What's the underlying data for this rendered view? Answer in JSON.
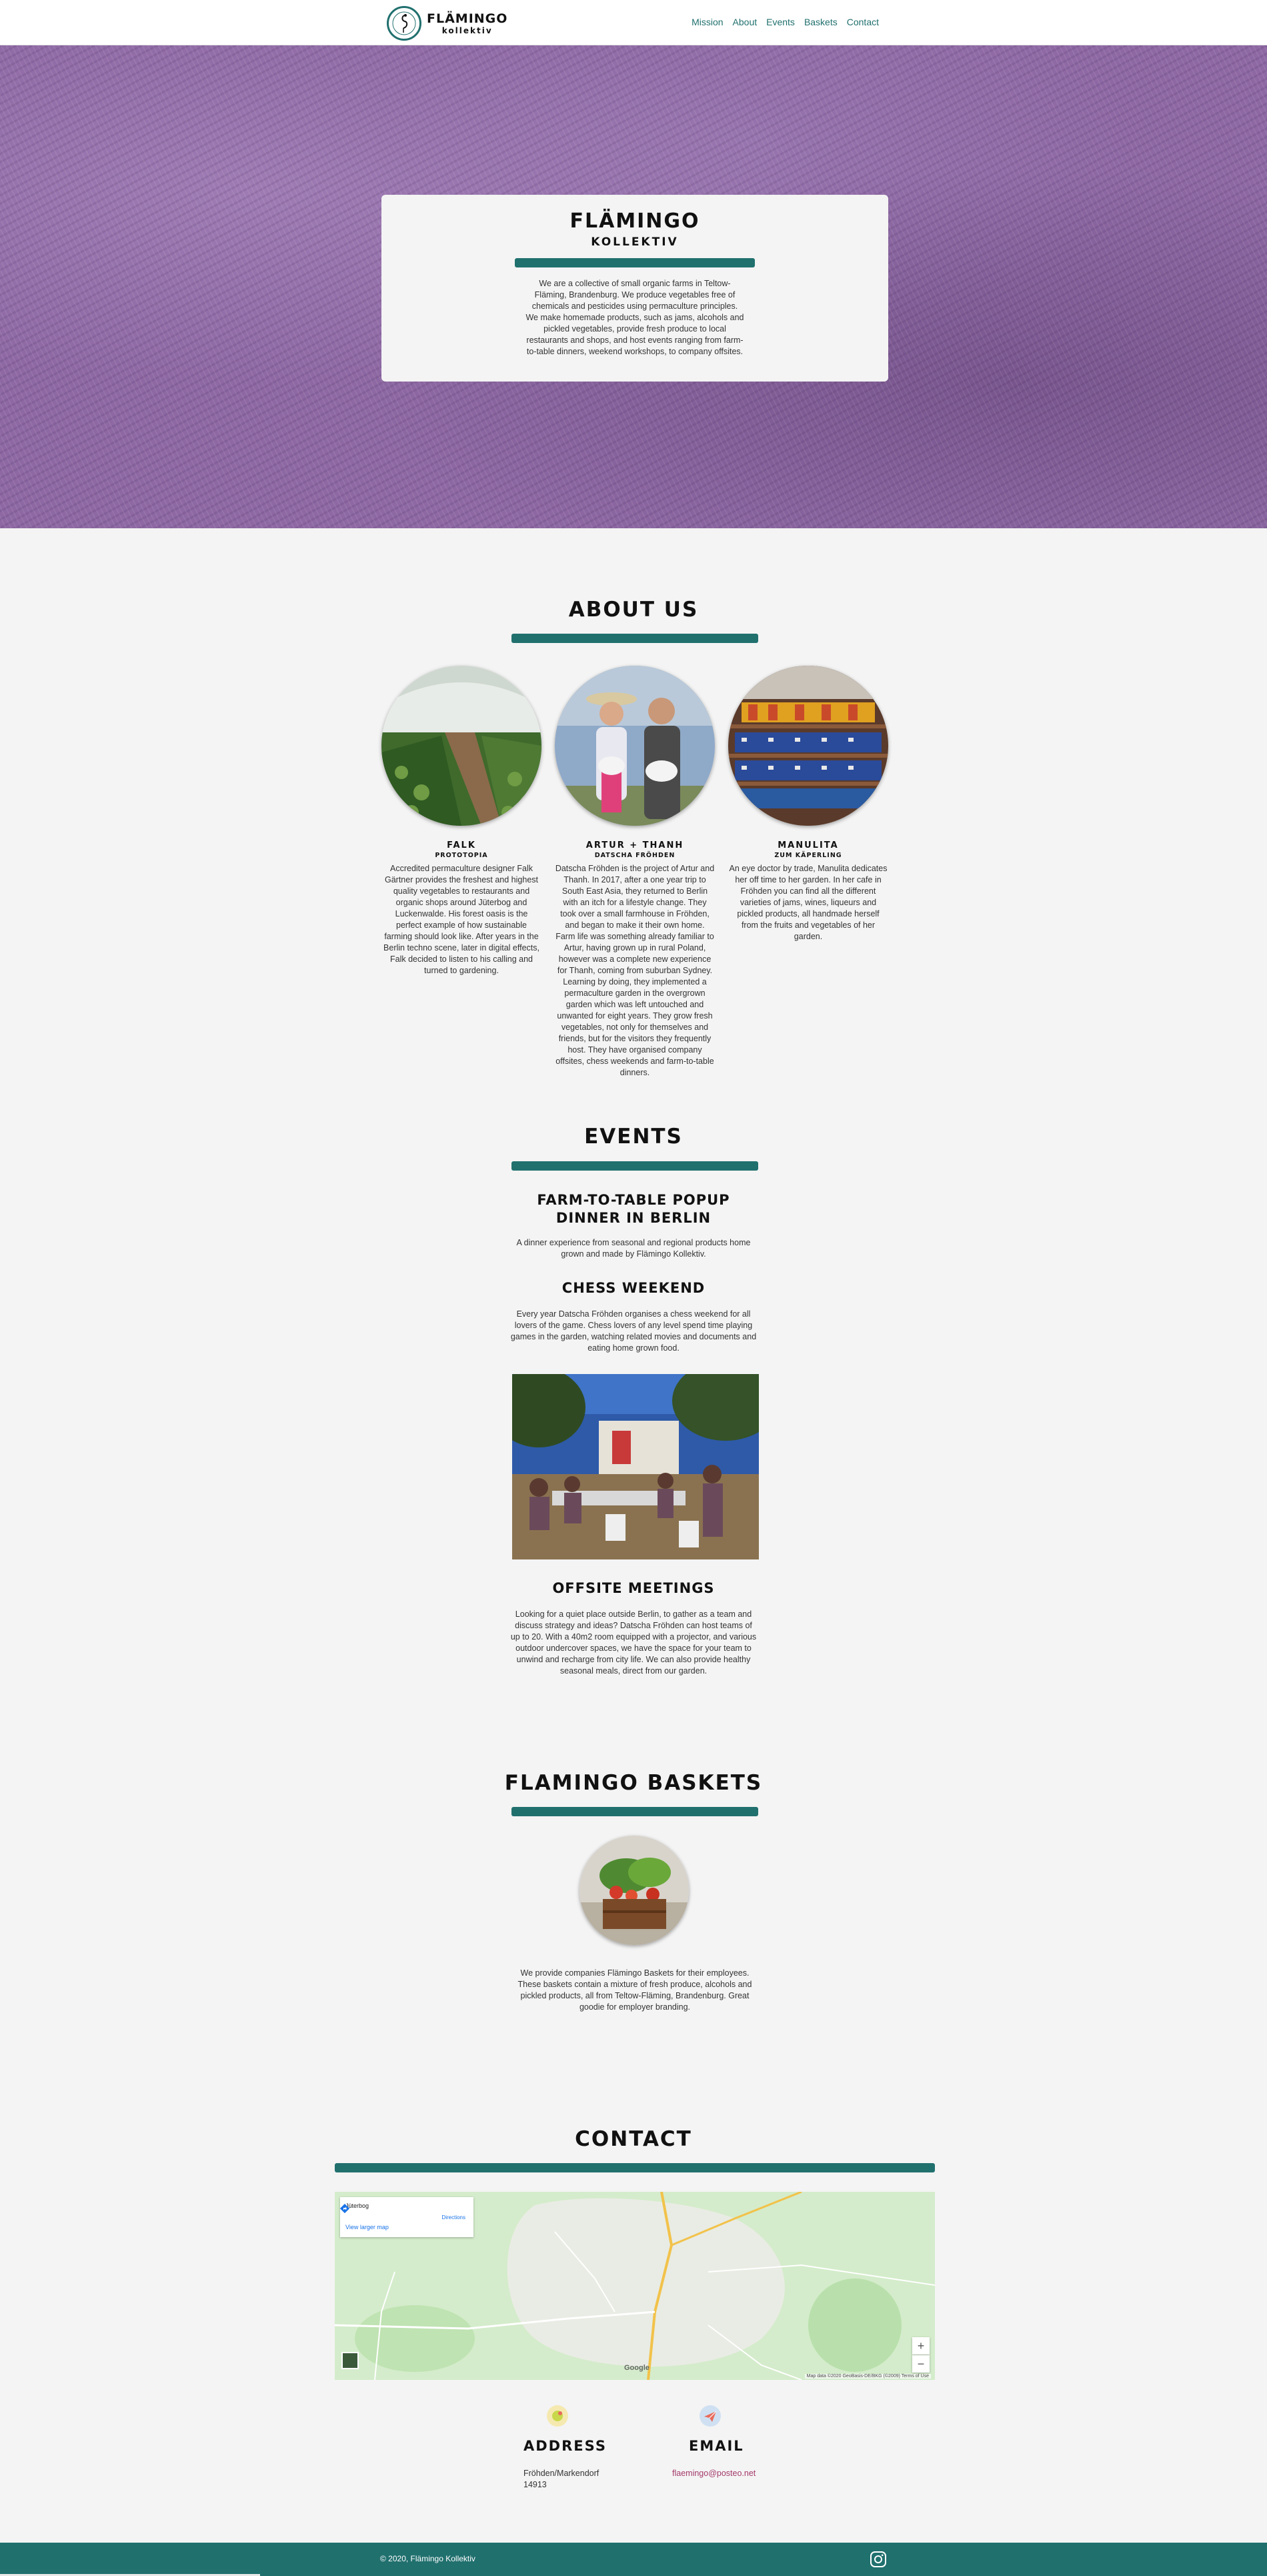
{
  "nav": {
    "logo_title": "FLÄMINGO",
    "logo_sub": "kollektiv",
    "links": [
      "Mission",
      "About",
      "Events",
      "Baskets",
      "Contact"
    ]
  },
  "hero": {
    "title": "FLÄMINGO",
    "subtitle": "KOLLEKTIV",
    "text": "We are a collective of small organic farms in Teltow-Fläming, Brandenburg. We produce vegetables free of chemicals and pesticides using permaculture principles. We make homemade products, such as jams, alcohols and pickled vegetables, provide fresh produce to local restaurants and shops, and host events ranging from farm-to-table dinners, weekend workshops, to company offsites."
  },
  "about": {
    "title": "ABOUT US",
    "people": [
      {
        "name": "FALK",
        "role": "PROTOTOPIA",
        "bio": "Accredited permaculture designer Falk Gärtner provides the freshest and highest quality vegetables to restaurants and organic shops around Jüterbog and Luckenwalde. His forest oasis is the perfect example of how sustainable farming should look like. After years in the Berlin techno scene, later in digital effects, Falk decided to listen to his calling and turned to gardening."
      },
      {
        "name": "ARTUR + THANH",
        "role": "DATSCHA FRÖHDEN",
        "bio": "Datscha Fröhden is the project of Artur and Thanh. In 2017, after a one year trip to South East Asia, they returned to Berlin with an itch for a lifestyle change. They took over a small farmhouse in Fröhden, and began to make it their own home. Farm life was something already familiar to Artur, having grown up in rural Poland, however was a complete new experience for Thanh, coming from suburban Sydney. Learning by doing, they implemented a permaculture garden in the overgrown garden which was left untouched and unwanted for eight years. They grow fresh vegetables, not only for themselves and friends, but for the visitors they frequently host. They have organised company offsites, chess weekends and farm-to-table dinners."
      },
      {
        "name": "MANULITA",
        "role": "ZUM KÄPERLING",
        "bio": "An eye doctor by trade, Manulita dedicates her off time to her garden. In her cafe in Fröhden you can find all the different varieties of jams, wines, liqueurs and pickled products, all handmade herself from the fruits and vegetables of her garden."
      }
    ]
  },
  "events": {
    "title": "EVENTS",
    "items": [
      {
        "title": "FARM-TO-TABLE POPUP DINNER IN BERLIN",
        "text": "A dinner experience from seasonal and regional products home grown and made by Flämingo Kollektiv."
      },
      {
        "title": "CHESS WEEKEND",
        "text": "Every year Datscha Fröhden organises a chess weekend for all lovers of the game. Chess lovers of any level spend time playing games in the garden, watching related movies and documents and eating home grown food."
      },
      {
        "title": "OFFSITE MEETINGS",
        "text": "Looking for a quiet place outside Berlin, to gather as a team and discuss strategy and ideas? Datscha Fröhden can host teams of up to 20. With a 40m2 room equipped with a projector, and various outdoor undercover spaces, we have the space for your team to unwind and recharge from city life. We can also provide healthy seasonal meals, direct from our garden."
      }
    ]
  },
  "baskets": {
    "title": "FLAMINGO BASKETS",
    "text": "We provide companies Flämingo Baskets for their employees. These baskets contain a mixture of fresh produce, alcohols and pickled products, all from Teltow-Fläming, Brandenburg. Great goodie for employer branding."
  },
  "contact": {
    "title": "CONTACT",
    "map": {
      "place": "Jüterbog",
      "directions": "Directions",
      "larger_map": "View larger map",
      "zoom_in": "+",
      "zoom_out": "−",
      "google": "Google",
      "footer": "Map data ©2020 GeoBasis-DE/BKG (©2009)    Terms of Use"
    },
    "address_label": "ADDRESS",
    "address_lines": [
      "Fröhden/Markendorf",
      "14913"
    ],
    "email_label": "EMAIL",
    "email": "flaemingo@posteo.net"
  },
  "footer": {
    "copyright": "© 2020, Flämingo Kollektiv"
  },
  "colors": {
    "accent": "#20706e",
    "hero_tint": "#8d68a3",
    "background": "#f4f4f4"
  },
  "icons": [
    "flamingo-logo-icon",
    "directions-icon",
    "map-layer-icon",
    "address-icon",
    "email-icon",
    "instagram-icon"
  ]
}
